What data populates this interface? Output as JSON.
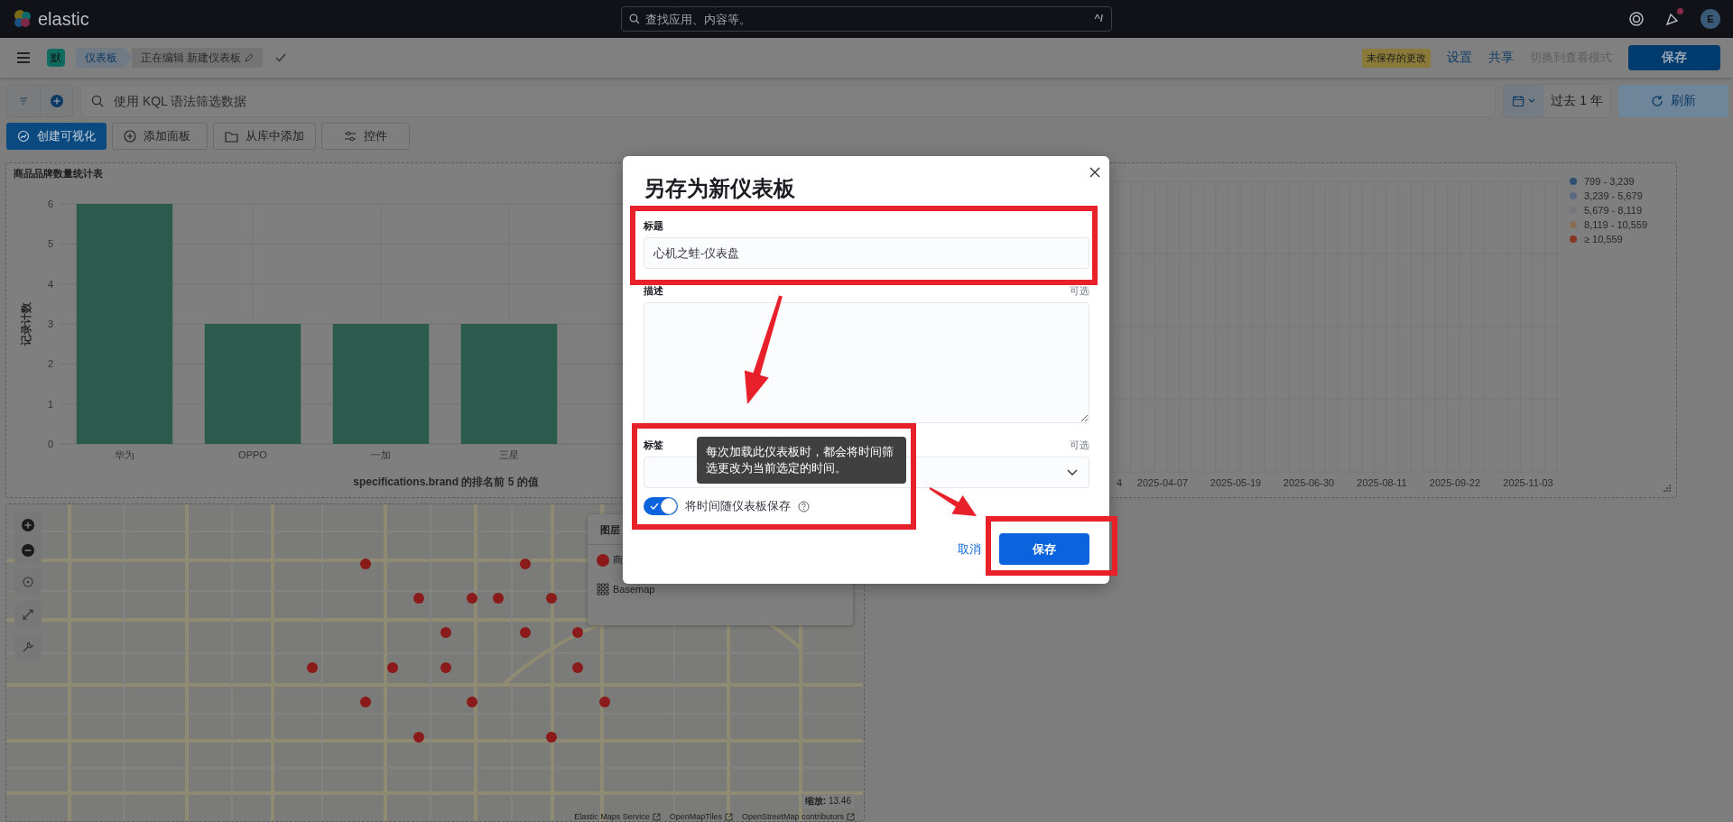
{
  "header": {
    "logo_text": "elastic",
    "search": {
      "placeholder": "查找应用、内容等。",
      "shortcut": "^/"
    },
    "news_unread": true,
    "avatar": "E"
  },
  "app_bar": {
    "space_initial": "默",
    "breadcrumbs": [
      {
        "label": "仪表板",
        "selected": false
      },
      {
        "label": "正在编辑 新建仪表板",
        "selected": true
      }
    ],
    "unsaved_badge": "未保存的更改",
    "links": [
      "设置",
      "共享"
    ],
    "view_mode": {
      "label": "切换到查看模式",
      "disabled": true
    },
    "save": "保存"
  },
  "query_bar": {
    "placeholder": "使用 KQL 语法筛选数据",
    "time_range": "过去 1 年",
    "refresh": "刷新"
  },
  "toolbar": [
    {
      "label": "创建可视化",
      "kind": "primary"
    },
    {
      "label": "添加面板",
      "kind": "secondary"
    },
    {
      "label": "从库中添加",
      "kind": "secondary"
    },
    {
      "label": "控件",
      "kind": "secondary"
    }
  ],
  "bar_panel": {
    "chart_data": {
      "type": "bar",
      "title": "商品品牌数量统计表",
      "xlabel": "specifications.brand 的排名前 5 的值",
      "ylabel": "记录计数",
      "categories": [
        "华为",
        "OPPO",
        "一加",
        "三星"
      ],
      "values": [
        6,
        3,
        3,
        3
      ],
      "grid": true,
      "ylim": [
        0,
        6
      ],
      "yticks": [
        0,
        1,
        2,
        3,
        4,
        5,
        6
      ]
    }
  },
  "time_panel": {
    "x_ticks": [
      "4",
      "2025-04-07",
      "2025-05-19",
      "2025-06-30",
      "2025-08-11",
      "2025-09-22",
      "2025-11-03"
    ],
    "legend": [
      {
        "label": "799 - 3,239",
        "color": "#2e4f70"
      },
      {
        "label": "3,239 - 5,679",
        "color": "#5b6a80"
      },
      {
        "label": "5,679 - 8,119",
        "color": "#76787d"
      },
      {
        "label": "8,119 - 10,559",
        "color": "#8a6c52"
      },
      {
        "label": "≥ 10,559",
        "color": "#8a3526"
      }
    ]
  },
  "map_panel": {
    "layers_title": "图层",
    "layers": [
      {
        "label": "商",
        "kind": "points"
      },
      {
        "label": "Basemap",
        "kind": "tiles"
      }
    ],
    "zoom_label": "缩放:",
    "zoom_value": "13.46",
    "attribution": [
      "Elastic Maps Service",
      "OpenMapTiles",
      "OpenStreetMap contributors"
    ]
  },
  "modal": {
    "title": "另存为新仪表板",
    "fields": [
      {
        "kind": "input",
        "label": "标题",
        "value": "心机之蛙-仪表盘"
      },
      {
        "kind": "textarea",
        "label": "描述",
        "optional": "可选"
      },
      {
        "kind": "combobox",
        "label": "标签",
        "optional": "可选"
      }
    ],
    "tooltip": "每次加载此仪表板时，都会将时间筛选更改为当前选定的时间。",
    "toggle": {
      "label": "将时间随仪表板保存",
      "on": true
    },
    "cancel": "取消",
    "confirm": "保存"
  }
}
